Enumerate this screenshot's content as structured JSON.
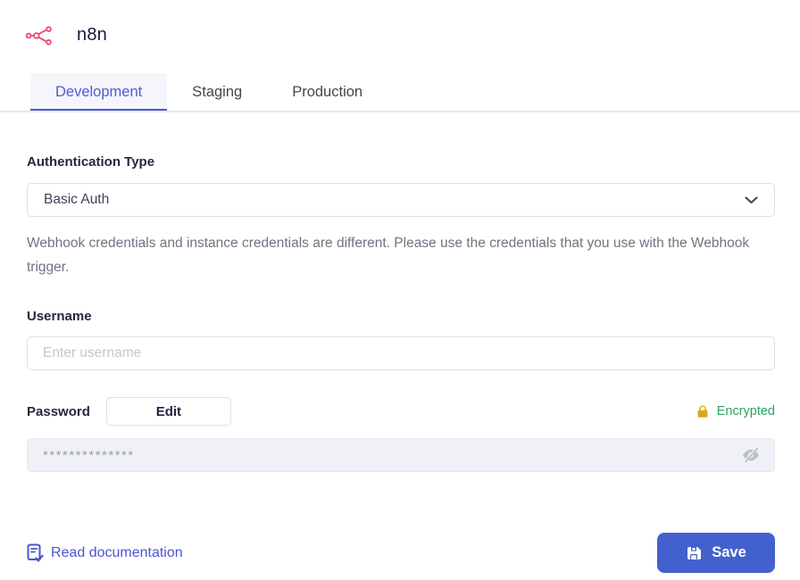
{
  "app": {
    "title": "n8n",
    "logo_icon": "n8n-nodes-icon"
  },
  "tabs": {
    "items": [
      {
        "label": "Development",
        "active": true
      },
      {
        "label": "Staging",
        "active": false
      },
      {
        "label": "Production",
        "active": false
      }
    ]
  },
  "form": {
    "auth_type": {
      "label": "Authentication Type",
      "value": "Basic Auth",
      "chevron_icon": "chevron-down-icon"
    },
    "help_text": "Webhook credentials and instance credentials are different. Please use the credentials that you use with the Webhook trigger.",
    "username": {
      "label": "Username",
      "placeholder": "Enter username",
      "value": ""
    },
    "password": {
      "label": "Password",
      "edit_button_label": "Edit",
      "encrypted_label": "Encrypted",
      "lock_icon": "lock-icon",
      "masked_value": "**************",
      "eye_icon": "eye-off-icon"
    }
  },
  "footer": {
    "doc_link_label": "Read documentation",
    "doc_icon": "document-check-icon",
    "save_button_label": "Save",
    "save_icon": "floppy-disk-icon"
  },
  "colors": {
    "brand_red": "#ea4b71",
    "primary_blue": "#4361ce",
    "link_indigo": "#4b55d1",
    "active_tab_blue": "#5059d6",
    "encrypted_green": "#2aa360",
    "lock_gold": "#d9a81c"
  }
}
